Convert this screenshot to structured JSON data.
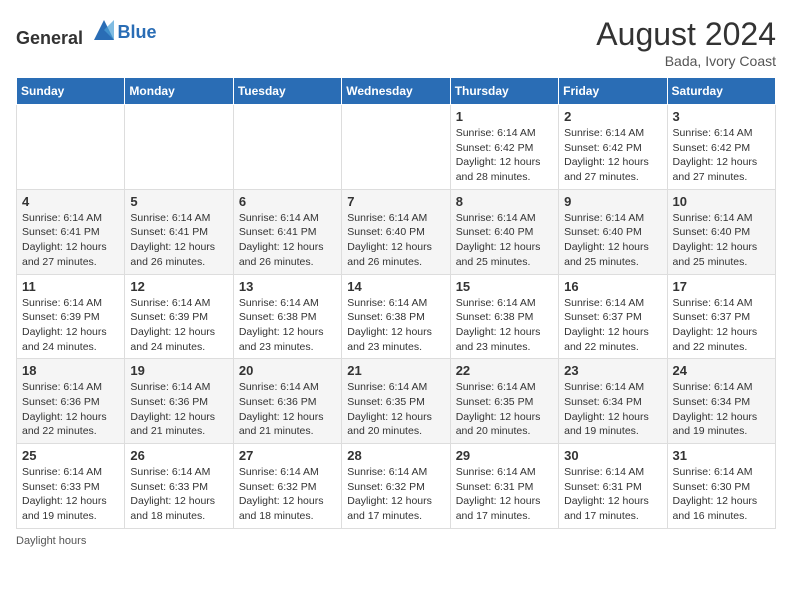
{
  "logo": {
    "general": "General",
    "blue": "Blue"
  },
  "title": {
    "month_year": "August 2024",
    "location": "Bada, Ivory Coast"
  },
  "days_of_week": [
    "Sunday",
    "Monday",
    "Tuesday",
    "Wednesday",
    "Thursday",
    "Friday",
    "Saturday"
  ],
  "footer": {
    "note": "Daylight hours"
  },
  "weeks": [
    [
      {
        "day": "",
        "info": ""
      },
      {
        "day": "",
        "info": ""
      },
      {
        "day": "",
        "info": ""
      },
      {
        "day": "",
        "info": ""
      },
      {
        "day": "1",
        "info": "Sunrise: 6:14 AM\nSunset: 6:42 PM\nDaylight: 12 hours\nand 28 minutes."
      },
      {
        "day": "2",
        "info": "Sunrise: 6:14 AM\nSunset: 6:42 PM\nDaylight: 12 hours\nand 27 minutes."
      },
      {
        "day": "3",
        "info": "Sunrise: 6:14 AM\nSunset: 6:42 PM\nDaylight: 12 hours\nand 27 minutes."
      }
    ],
    [
      {
        "day": "4",
        "info": "Sunrise: 6:14 AM\nSunset: 6:41 PM\nDaylight: 12 hours\nand 27 minutes."
      },
      {
        "day": "5",
        "info": "Sunrise: 6:14 AM\nSunset: 6:41 PM\nDaylight: 12 hours\nand 26 minutes."
      },
      {
        "day": "6",
        "info": "Sunrise: 6:14 AM\nSunset: 6:41 PM\nDaylight: 12 hours\nand 26 minutes."
      },
      {
        "day": "7",
        "info": "Sunrise: 6:14 AM\nSunset: 6:40 PM\nDaylight: 12 hours\nand 26 minutes."
      },
      {
        "day": "8",
        "info": "Sunrise: 6:14 AM\nSunset: 6:40 PM\nDaylight: 12 hours\nand 25 minutes."
      },
      {
        "day": "9",
        "info": "Sunrise: 6:14 AM\nSunset: 6:40 PM\nDaylight: 12 hours\nand 25 minutes."
      },
      {
        "day": "10",
        "info": "Sunrise: 6:14 AM\nSunset: 6:40 PM\nDaylight: 12 hours\nand 25 minutes."
      }
    ],
    [
      {
        "day": "11",
        "info": "Sunrise: 6:14 AM\nSunset: 6:39 PM\nDaylight: 12 hours\nand 24 minutes."
      },
      {
        "day": "12",
        "info": "Sunrise: 6:14 AM\nSunset: 6:39 PM\nDaylight: 12 hours\nand 24 minutes."
      },
      {
        "day": "13",
        "info": "Sunrise: 6:14 AM\nSunset: 6:38 PM\nDaylight: 12 hours\nand 23 minutes."
      },
      {
        "day": "14",
        "info": "Sunrise: 6:14 AM\nSunset: 6:38 PM\nDaylight: 12 hours\nand 23 minutes."
      },
      {
        "day": "15",
        "info": "Sunrise: 6:14 AM\nSunset: 6:38 PM\nDaylight: 12 hours\nand 23 minutes."
      },
      {
        "day": "16",
        "info": "Sunrise: 6:14 AM\nSunset: 6:37 PM\nDaylight: 12 hours\nand 22 minutes."
      },
      {
        "day": "17",
        "info": "Sunrise: 6:14 AM\nSunset: 6:37 PM\nDaylight: 12 hours\nand 22 minutes."
      }
    ],
    [
      {
        "day": "18",
        "info": "Sunrise: 6:14 AM\nSunset: 6:36 PM\nDaylight: 12 hours\nand 22 minutes."
      },
      {
        "day": "19",
        "info": "Sunrise: 6:14 AM\nSunset: 6:36 PM\nDaylight: 12 hours\nand 21 minutes."
      },
      {
        "day": "20",
        "info": "Sunrise: 6:14 AM\nSunset: 6:36 PM\nDaylight: 12 hours\nand 21 minutes."
      },
      {
        "day": "21",
        "info": "Sunrise: 6:14 AM\nSunset: 6:35 PM\nDaylight: 12 hours\nand 20 minutes."
      },
      {
        "day": "22",
        "info": "Sunrise: 6:14 AM\nSunset: 6:35 PM\nDaylight: 12 hours\nand 20 minutes."
      },
      {
        "day": "23",
        "info": "Sunrise: 6:14 AM\nSunset: 6:34 PM\nDaylight: 12 hours\nand 19 minutes."
      },
      {
        "day": "24",
        "info": "Sunrise: 6:14 AM\nSunset: 6:34 PM\nDaylight: 12 hours\nand 19 minutes."
      }
    ],
    [
      {
        "day": "25",
        "info": "Sunrise: 6:14 AM\nSunset: 6:33 PM\nDaylight: 12 hours\nand 19 minutes."
      },
      {
        "day": "26",
        "info": "Sunrise: 6:14 AM\nSunset: 6:33 PM\nDaylight: 12 hours\nand 18 minutes."
      },
      {
        "day": "27",
        "info": "Sunrise: 6:14 AM\nSunset: 6:32 PM\nDaylight: 12 hours\nand 18 minutes."
      },
      {
        "day": "28",
        "info": "Sunrise: 6:14 AM\nSunset: 6:32 PM\nDaylight: 12 hours\nand 17 minutes."
      },
      {
        "day": "29",
        "info": "Sunrise: 6:14 AM\nSunset: 6:31 PM\nDaylight: 12 hours\nand 17 minutes."
      },
      {
        "day": "30",
        "info": "Sunrise: 6:14 AM\nSunset: 6:31 PM\nDaylight: 12 hours\nand 17 minutes."
      },
      {
        "day": "31",
        "info": "Sunrise: 6:14 AM\nSunset: 6:30 PM\nDaylight: 12 hours\nand 16 minutes."
      }
    ]
  ]
}
